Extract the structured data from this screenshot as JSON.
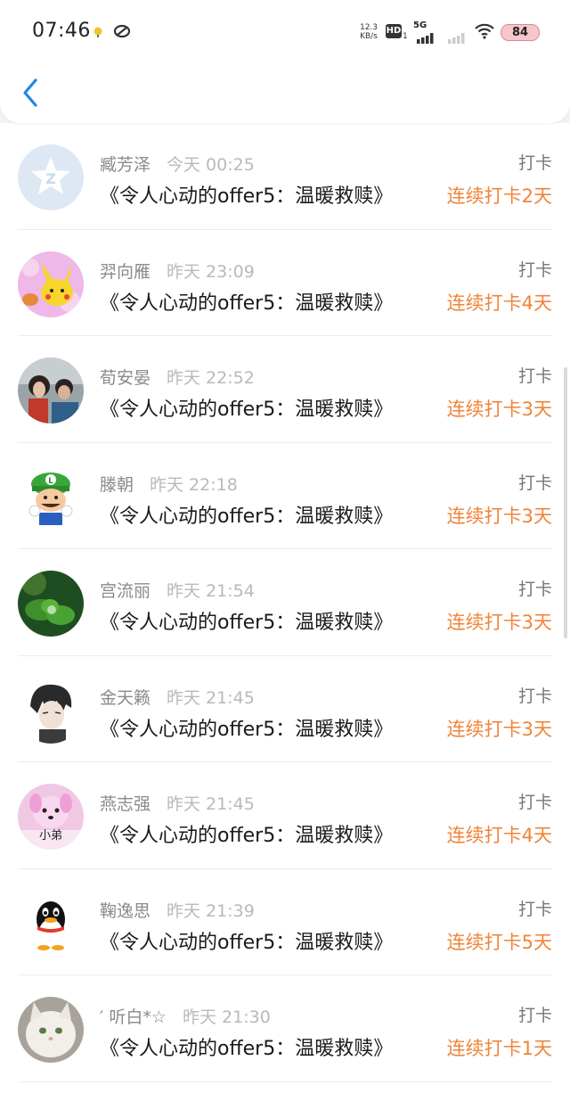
{
  "status_bar": {
    "time": "07:46",
    "net_speed_value": "12.3",
    "net_speed_unit": "KB/s",
    "hd": "HD",
    "hd_sub": "1",
    "network": "5G",
    "battery": "84"
  },
  "colors": {
    "accent_orange": "#f0843a",
    "back_arrow": "#1e88e5",
    "text_primary": "#1a1a1a",
    "text_secondary": "#8a8a8a"
  },
  "items": [
    {
      "name": "臧芳泽",
      "time": "今天 00:25",
      "title": "《令人心动的offer5：温暖救赎》",
      "tag": "打卡",
      "streak": "连续打卡2天",
      "avatar": "qq-zone-logo-avatar"
    },
    {
      "name": "羿向雁",
      "time": "昨天 23:09",
      "title": "《令人心动的offer5：温暖救赎》",
      "tag": "打卡",
      "streak": "连续打卡4天",
      "avatar": "pikachu-avatar"
    },
    {
      "name": "荀安晏",
      "time": "昨天 22:52",
      "title": "《令人心动的offer5：温暖救赎》",
      "tag": "打卡",
      "streak": "连续打卡3天",
      "avatar": "couple-photo-avatar"
    },
    {
      "name": "滕朝",
      "time": "昨天 22:18",
      "title": "《令人心动的offer5：温暖救赎》",
      "tag": "打卡",
      "streak": "连续打卡3天",
      "avatar": "luigi-avatar"
    },
    {
      "name": "宫流丽",
      "time": "昨天 21:54",
      "title": "《令人心动的offer5：温暖救赎》",
      "tag": "打卡",
      "streak": "连续打卡3天",
      "avatar": "leaf-droplet-avatar"
    },
    {
      "name": "金天籁",
      "time": "昨天 21:45",
      "title": "《令人心动的offer5：温暖救赎》",
      "tag": "打卡",
      "streak": "连续打卡3天",
      "avatar": "anime-boy-avatar"
    },
    {
      "name": "燕志强",
      "time": "昨天 21:45",
      "title": "《令人心动的offer5：温暖救赎》",
      "tag": "打卡",
      "streak": "连续打卡4天",
      "avatar": "pink-puppy-avatar",
      "avatar_text": "小弟"
    },
    {
      "name": "鞠逸思",
      "time": "昨天 21:39",
      "title": "《令人心动的offer5：温暖救赎》",
      "tag": "打卡",
      "streak": "连续打卡5天",
      "avatar": "qq-penguin-avatar"
    },
    {
      "name": "′ 听白*☆",
      "time": "昨天 21:30",
      "title": "《令人心动的offer5：温暖救赎》",
      "tag": "打卡",
      "streak": "连续打卡1天",
      "avatar": "white-cat-avatar"
    }
  ]
}
